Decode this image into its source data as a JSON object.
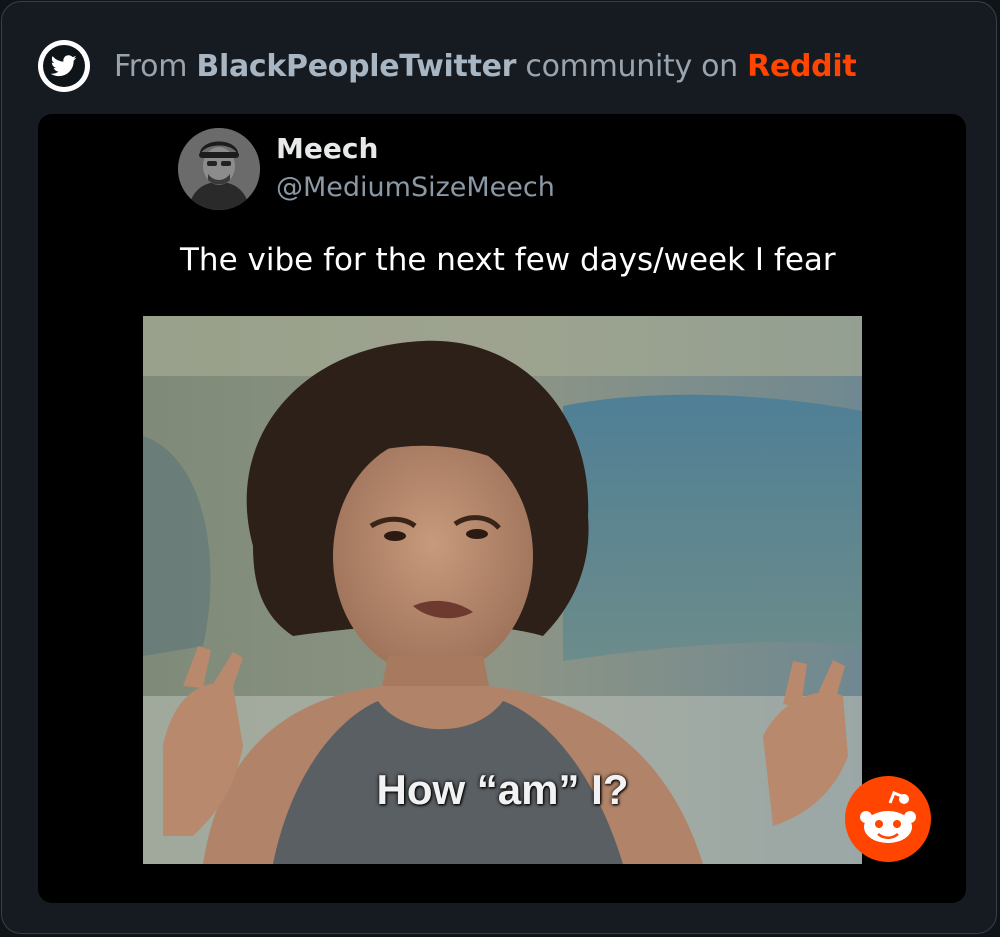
{
  "header": {
    "prefix": "From",
    "community": "BlackPeopleTwitter",
    "middle": "community on",
    "platform": "Reddit"
  },
  "tweet": {
    "author_name": "Meech",
    "author_handle": "@MediumSizeMeech",
    "text": "The vibe for the next few days/week I fear",
    "image_caption": "How “am” I?"
  },
  "icons": {
    "badge": "twitter-bird-icon",
    "avatar": "avatar",
    "corner": "reddit-snoo-icon"
  },
  "colors": {
    "reddit": "#ff4500",
    "background": "#161b22",
    "post_background": "#000000"
  }
}
